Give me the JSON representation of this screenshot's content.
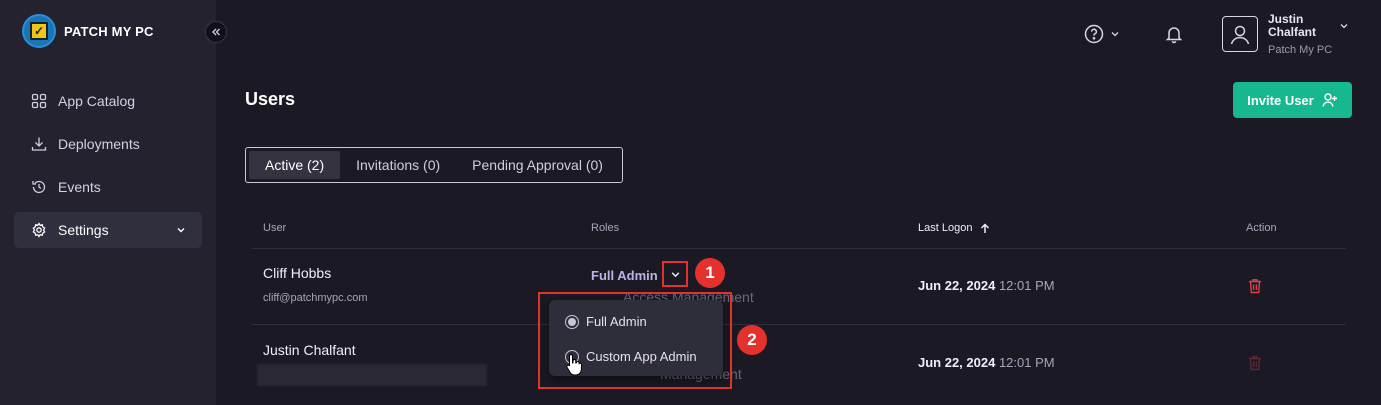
{
  "app": {
    "brand": "PATCH MY PC"
  },
  "sidebar": {
    "items": [
      {
        "label": "App Catalog",
        "icon": "grid-icon"
      },
      {
        "label": "Deployments",
        "icon": "download-icon"
      },
      {
        "label": "Events",
        "icon": "history-icon"
      },
      {
        "label": "Settings",
        "icon": "gear-icon",
        "active": true
      }
    ]
  },
  "header": {
    "user_name": "Justin Chalfant",
    "user_org": "Patch My PC"
  },
  "page": {
    "title": "Users",
    "invite_label": "Invite User"
  },
  "tabs": [
    {
      "label": "Active (2)",
      "active": true
    },
    {
      "label": "Invitations (0)"
    },
    {
      "label": "Pending Approval (0)"
    }
  ],
  "table": {
    "columns": {
      "user": "User",
      "roles": "Roles",
      "last_logon": "Last Logon",
      "action": "Action"
    },
    "rows": [
      {
        "name": "Cliff Hobbs",
        "email": "cliff@patchmypc.com",
        "role": "Full Admin",
        "ghost": "Access Management",
        "date": "Jun 22, 2024",
        "time": "12:01 PM"
      },
      {
        "name": "Justin Chalfant",
        "email": "",
        "ghost": "Management",
        "date": "Jun 22, 2024",
        "time": "12:01 PM"
      }
    ]
  },
  "role_dropdown": {
    "options": [
      {
        "label": "Full Admin",
        "selected": true
      },
      {
        "label": "Custom App Admin",
        "selected": false
      }
    ]
  },
  "annotations": {
    "badge1": "1",
    "badge2": "2"
  },
  "colors": {
    "accent": "#17b890",
    "highlight": "#e5312d",
    "danger": "#e0414f"
  }
}
